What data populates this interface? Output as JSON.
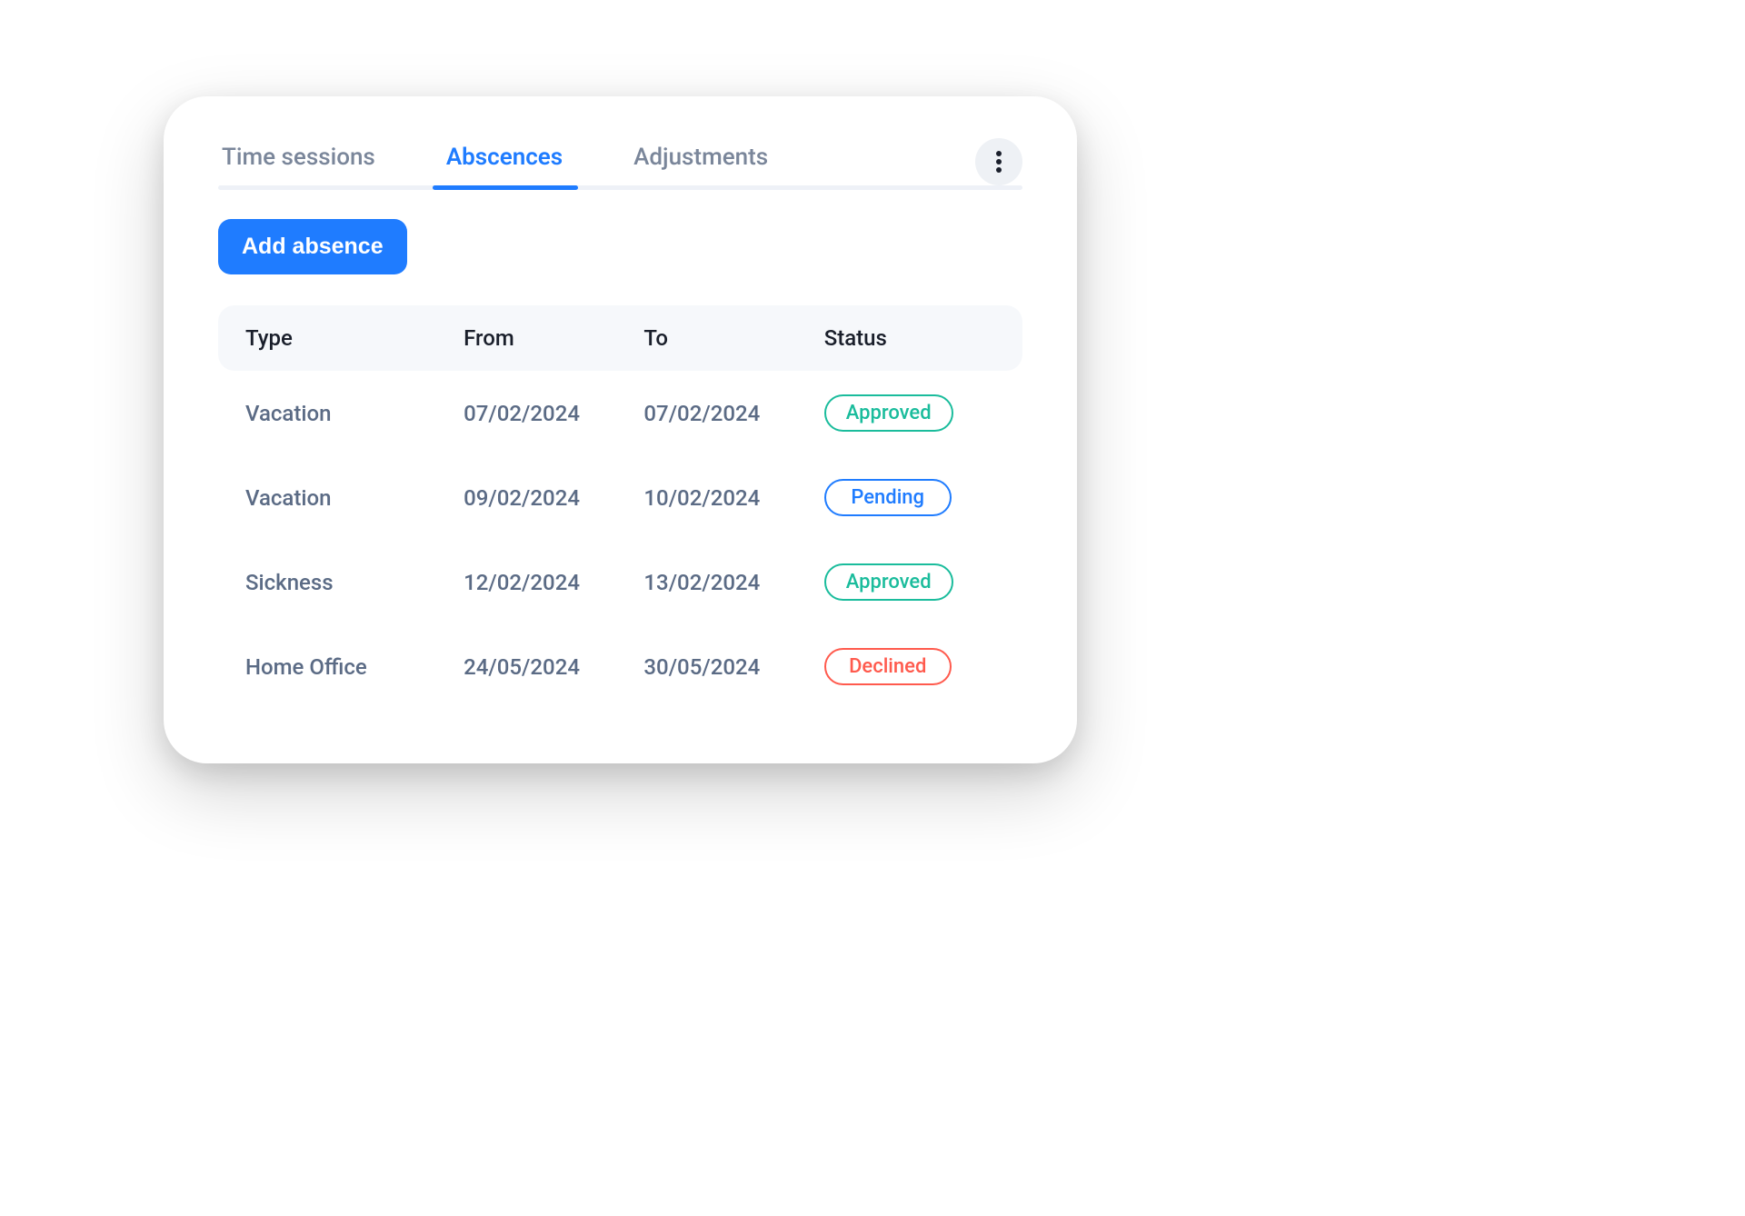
{
  "tabs": {
    "items": [
      {
        "label": "Time sessions",
        "active": false
      },
      {
        "label": "Abscences",
        "active": true
      },
      {
        "label": "Adjustments",
        "active": false
      }
    ]
  },
  "actions": {
    "add_label": "Add absence"
  },
  "table": {
    "headers": {
      "type": "Type",
      "from": "From",
      "to": "To",
      "status": "Status"
    },
    "rows": [
      {
        "type": "Vacation",
        "from": "07/02/2024",
        "to": "07/02/2024",
        "status": "Approved",
        "status_kind": "approved"
      },
      {
        "type": "Vacation",
        "from": "09/02/2024",
        "to": "10/02/2024",
        "status": "Pending",
        "status_kind": "pending"
      },
      {
        "type": "Sickness",
        "from": "12/02/2024",
        "to": "13/02/2024",
        "status": "Approved",
        "status_kind": "approved"
      },
      {
        "type": "Home Office",
        "from": "24/05/2024",
        "to": "30/05/2024",
        "status": "Declined",
        "status_kind": "declined"
      }
    ]
  },
  "colors": {
    "accent": "#1f7cff",
    "approved": "#1abc9c",
    "pending": "#1f7cff",
    "declined": "#ff5a4d"
  }
}
